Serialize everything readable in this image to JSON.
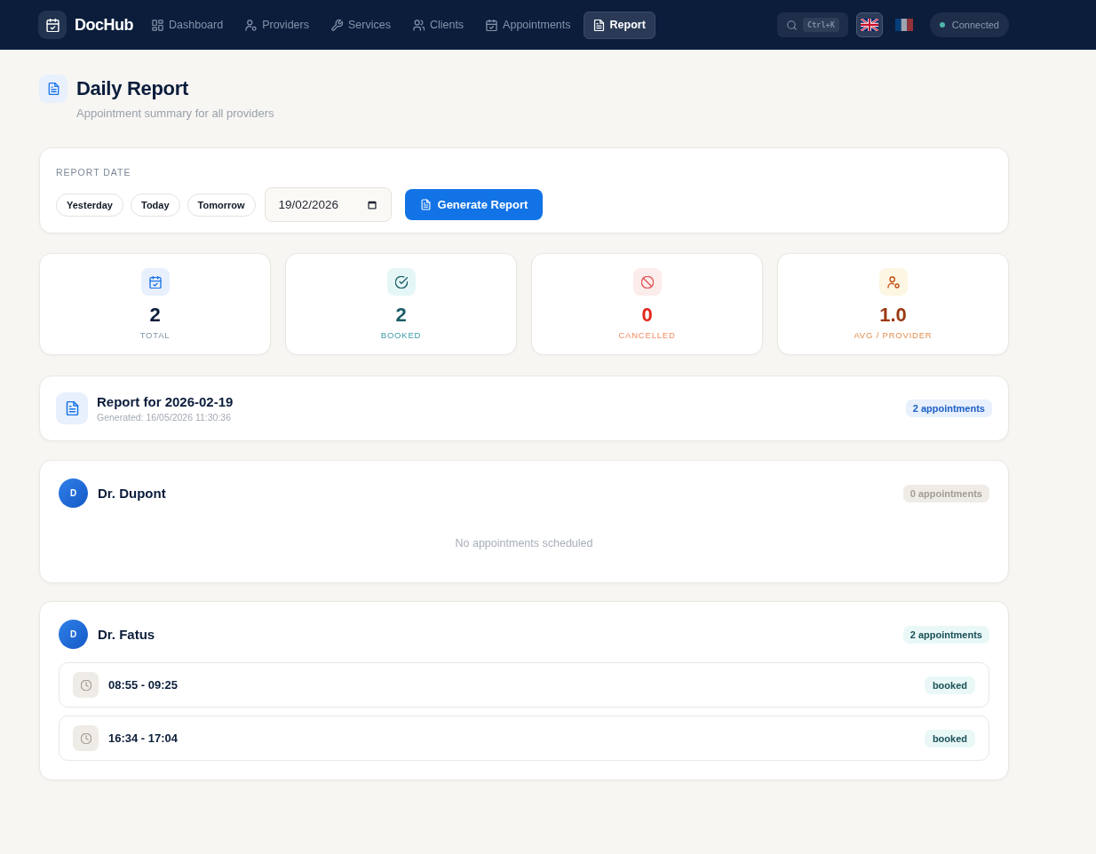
{
  "navbar": {
    "brand": "DocHub",
    "items": [
      {
        "kind": "dashboard",
        "label": "Dashboard",
        "selected": false
      },
      {
        "kind": "providers",
        "label": "Providers",
        "selected": false
      },
      {
        "kind": "services",
        "label": "Services",
        "selected": false
      },
      {
        "kind": "clients",
        "label": "Clients",
        "selected": false
      },
      {
        "kind": "appointments",
        "label": "Appointments",
        "selected": false
      },
      {
        "kind": "report",
        "label": "Report",
        "selected": true
      }
    ],
    "search": {
      "shortcut": "Ctrl+K"
    },
    "languages": [
      {
        "kind": "en",
        "selected": true
      },
      {
        "kind": "fr",
        "selected": false
      }
    ],
    "connection": {
      "label": "Connected",
      "connected": true
    }
  },
  "header": {
    "title": "Daily Report",
    "subtitle": "Appointment summary for all providers"
  },
  "date_picker": {
    "label": "REPORT DATE",
    "presets": [
      "Yesterday",
      "Today",
      "Tomorrow"
    ],
    "date": "19/02/2026",
    "button": "Generate Report"
  },
  "stats": [
    {
      "kind": "total",
      "value": "2",
      "label": "TOTAL"
    },
    {
      "kind": "booked",
      "value": "2",
      "label": "BOOKED"
    },
    {
      "kind": "cancelled",
      "value": "0",
      "label": "CANCELLED"
    },
    {
      "kind": "average",
      "value": "1.0",
      "label": "AVG / PROVIDER"
    }
  ],
  "report": {
    "title": "Report for 2026-02-19",
    "generated": "Generated: 16/05/2026 11:30:36",
    "count": "2 appointments"
  },
  "providers": [
    {
      "initial": "D",
      "name": "Dr. Dupont",
      "count": "0 appointments",
      "empty_message": "No appointments scheduled"
    },
    {
      "initial": "D",
      "name": "Dr. Fatus",
      "count": "2 appointments",
      "appointments": [
        {
          "time": "08:55 - 09:25",
          "status": "booked"
        },
        {
          "time": "16:34 - 17:04",
          "status": "booked"
        }
      ]
    }
  ]
}
